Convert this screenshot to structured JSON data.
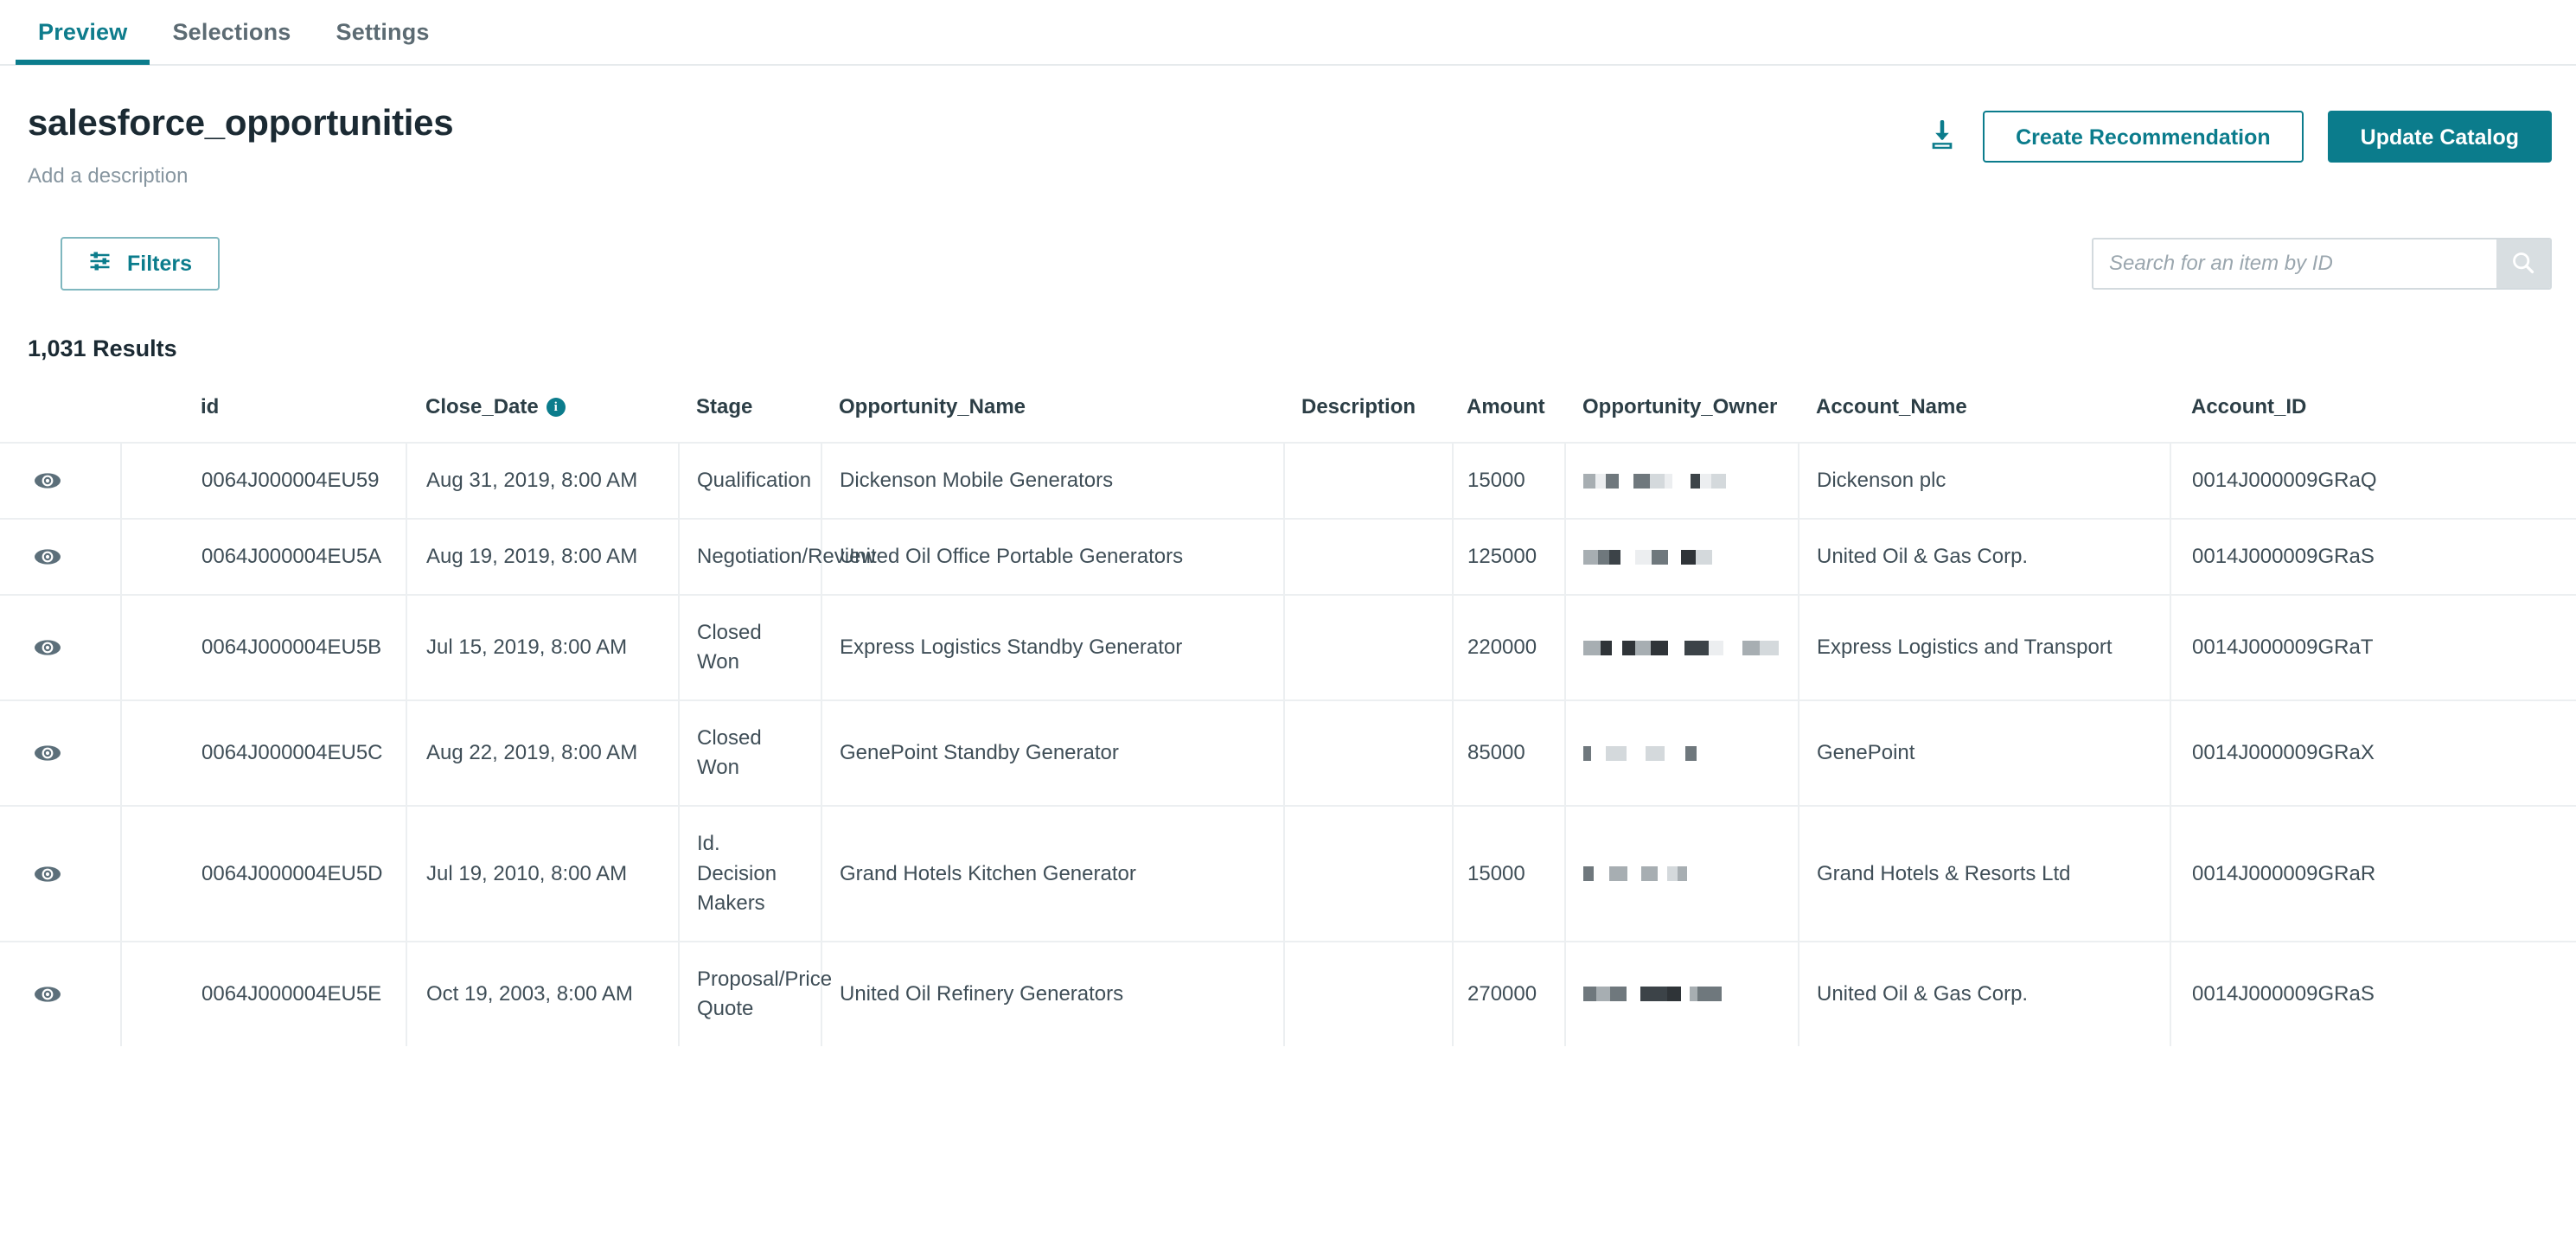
{
  "theme": {
    "accent": "#0b7c8c",
    "text": "#2c3e46",
    "muted": "#8796a0",
    "border": "#eceff1"
  },
  "tabs": [
    {
      "label": "Preview",
      "active": true
    },
    {
      "label": "Selections",
      "active": false
    },
    {
      "label": "Settings",
      "active": false
    }
  ],
  "header": {
    "title": "salesforce_opportunities",
    "description": "Add a description",
    "download_icon": "download-icon",
    "create_recommendation_label": "Create Recommendation",
    "update_catalog_label": "Update Catalog"
  },
  "toolbar": {
    "filters_label": "Filters",
    "filters_icon": "sliders-icon",
    "search_placeholder": "Search for an item by ID",
    "search_value": "",
    "search_icon": "search-icon"
  },
  "results": {
    "count_label": "1,031 Results"
  },
  "table": {
    "row_icon": "eye-icon",
    "columns": [
      {
        "key": "eye",
        "label": ""
      },
      {
        "key": "id",
        "label": "id"
      },
      {
        "key": "close",
        "label": "Close_Date",
        "info": true,
        "info_icon": "info-icon"
      },
      {
        "key": "stage",
        "label": "Stage"
      },
      {
        "key": "oppname",
        "label": "Opportunity_Name"
      },
      {
        "key": "desc",
        "label": "Description"
      },
      {
        "key": "amount",
        "label": "Amount"
      },
      {
        "key": "owner",
        "label": "Opportunity_Owner"
      },
      {
        "key": "account",
        "label": "Account_Name"
      },
      {
        "key": "acctid",
        "label": "Account_ID"
      }
    ],
    "rows": [
      {
        "id": "0064J000004EU59",
        "close": "Aug 31, 2019, 8:00 AM",
        "stage": "Qualification",
        "oppname": "Dickenson Mobile Generators",
        "desc": "",
        "amount": "15000",
        "owner": "[redacted]",
        "account": "Dickenson plc",
        "acctid": "0014J000009GRaQ"
      },
      {
        "id": "0064J000004EU5A",
        "close": "Aug 19, 2019, 8:00 AM",
        "stage": "Negotiation/Review",
        "oppname": "United Oil Office Portable Generators",
        "desc": "",
        "amount": "125000",
        "owner": "[redacted]",
        "account": "United Oil & Gas Corp.",
        "acctid": "0014J000009GRaS"
      },
      {
        "id": "0064J000004EU5B",
        "close": "Jul 15, 2019, 8:00 AM",
        "stage": "Closed Won",
        "oppname": "Express Logistics Standby Generator",
        "desc": "",
        "amount": "220000",
        "owner": "[redacted]",
        "account": "Express Logistics and Transport",
        "acctid": "0014J000009GRaT"
      },
      {
        "id": "0064J000004EU5C",
        "close": "Aug 22, 2019, 8:00 AM",
        "stage": "Closed Won",
        "oppname": "GenePoint Standby Generator",
        "desc": "",
        "amount": "85000",
        "owner": "[redacted]",
        "account": "GenePoint",
        "acctid": "0014J000009GRaX"
      },
      {
        "id": "0064J000004EU5D",
        "close": "Jul 19, 2010, 8:00 AM",
        "stage": "Id. Decision Makers",
        "oppname": "Grand Hotels Kitchen Generator",
        "desc": "",
        "amount": "15000",
        "owner": "[redacted]",
        "account": "Grand Hotels & Resorts Ltd",
        "acctid": "0014J000009GRaR"
      },
      {
        "id": "0064J000004EU5E",
        "close": "Oct 19, 2003, 8:00 AM",
        "stage": "Proposal/Price Quote",
        "oppname": "United Oil Refinery Generators",
        "desc": "",
        "amount": "270000",
        "owner": "[redacted]",
        "account": "United Oil & Gas Corp.",
        "acctid": "0014J000009GRaS"
      }
    ]
  }
}
